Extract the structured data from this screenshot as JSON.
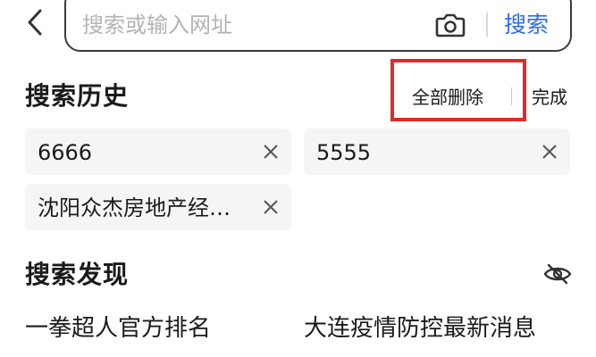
{
  "search_bar": {
    "placeholder": "搜索或输入网址",
    "submit_label": "搜索",
    "back_icon": "chevron-left-icon",
    "camera_icon": "camera-icon",
    "accent_color": "#2f6cf0"
  },
  "history": {
    "title": "搜索历史",
    "delete_all_label": "全部删除",
    "done_label": "完成",
    "highlight_color": "#e02a2a",
    "items": [
      {
        "label": "6666"
      },
      {
        "label": "5555"
      },
      {
        "label": "沈阳众杰房地产经…"
      }
    ]
  },
  "discover": {
    "title": "搜索发现",
    "visibility_icon": "eye-off-icon",
    "items": [
      {
        "label": "一拳超人官方排名"
      },
      {
        "label": "大连疫情防控最新消息"
      }
    ]
  }
}
